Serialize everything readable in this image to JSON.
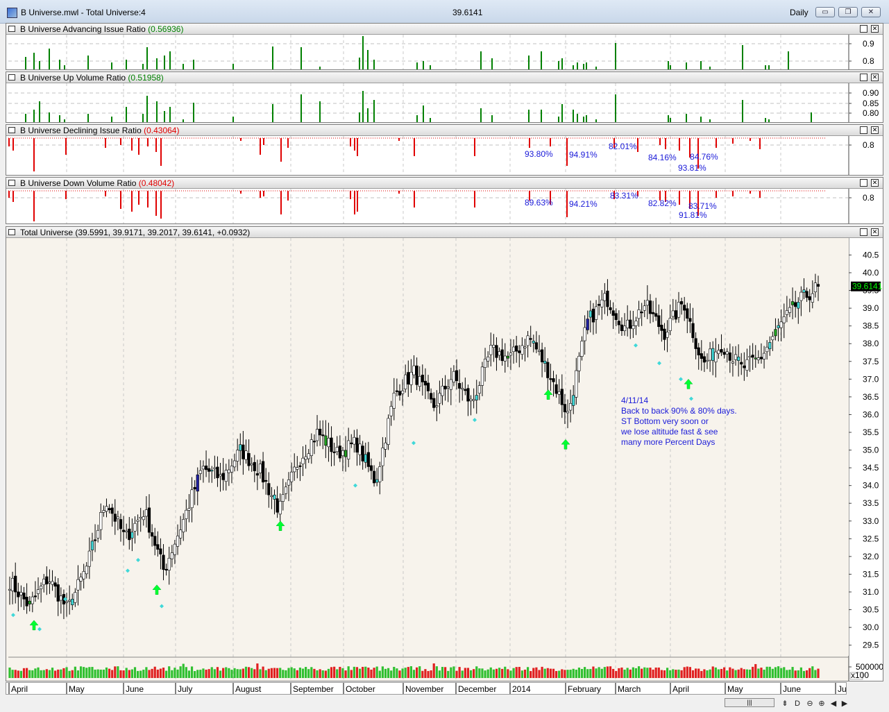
{
  "window": {
    "title": "B Universe.mwl - Total Universe:4",
    "last_price": "39.6141",
    "period": "Daily",
    "minimize_glyph": "▭",
    "restore_glyph": "❐",
    "close_glyph": "✕"
  },
  "panes": {
    "adv": {
      "name": "B Universe Advancing Issue Ratio",
      "value": "(0.56936)",
      "ticks": [
        "0.9",
        "0.8"
      ]
    },
    "upv": {
      "name": "B Universe Up Volume Ratio",
      "value": "(0.51958)",
      "ticks": [
        "0.90",
        "0.85",
        "0.80"
      ]
    },
    "dec": {
      "name": "B Universe Declining Issue Ratio",
      "value": "(0.43064)",
      "ticks": [
        "0.8"
      ],
      "annotations": [
        "93.80%",
        "94.91%",
        "82.01%",
        "84.16%",
        "84.76%",
        "93.81%"
      ]
    },
    "dnv": {
      "name": "B Universe Down Volume Ratio",
      "value": "(0.48042)",
      "ticks": [
        "0.8"
      ],
      "annotations": [
        "89.63%",
        "94.21%",
        "83.31%",
        "82.82%",
        "83.71%",
        "91.81%"
      ]
    },
    "price": {
      "name": "Total Universe",
      "value": "(39.5991, 39.9171, 39.2017, 39.6141, +0.0932)",
      "last_label": "39.6141"
    },
    "volume": {
      "tick": "500000",
      "scale_label": "x100"
    }
  },
  "note": {
    "lines": [
      "4/11/14",
      "Back to back 90% & 80% days.",
      "ST Bottom very soon or",
      "we lose altitude fast & see",
      "many more Percent Days"
    ]
  },
  "months": [
    "April",
    "May",
    "June",
    "July",
    "August",
    "September",
    "October",
    "November",
    "December",
    "2014",
    "February",
    "March",
    "April",
    "May",
    "June",
    "Jul"
  ],
  "colors": {
    "up": "#008000",
    "down": "#e00000",
    "annotation": "#1a1ad8",
    "chart_bg": "#f7f3ec",
    "last_price_bg": "#000000",
    "last_price_fg": "#00ff00",
    "arrow": "#00ff33",
    "dot": "#40d8d8"
  },
  "chart_data": {
    "type": "candlestick",
    "title": "Total Universe",
    "y_ticks": [
      29.5,
      30.0,
      30.5,
      31.0,
      31.5,
      32.0,
      32.5,
      33.0,
      33.5,
      34.0,
      34.5,
      35.0,
      35.5,
      36.0,
      36.5,
      37.0,
      37.5,
      38.0,
      38.5,
      39.0,
      39.5,
      40.0,
      40.5
    ],
    "ylim": [
      29.2,
      40.9
    ],
    "x_labels": [
      "April",
      "May",
      "June",
      "July",
      "August",
      "September",
      "October",
      "November",
      "December",
      "2014",
      "February",
      "March",
      "April",
      "May",
      "June",
      "Jul"
    ],
    "last": {
      "open": 39.5991,
      "high": 39.9171,
      "low": 39.2017,
      "close": 39.6141,
      "change": 0.0932
    },
    "close_path_anchors": [
      31.3,
      30.6,
      31.4,
      30.5,
      31.7,
      33.6,
      32.5,
      33.3,
      31.6,
      33.0,
      34.5,
      34.2,
      35.0,
      34.4,
      33.3,
      34.7,
      35.5,
      34.9,
      35.2,
      34.1,
      36.6,
      37.2,
      36.2,
      37.1,
      36.3,
      37.8,
      37.6,
      38.2,
      37.2,
      36.0,
      38.6,
      39.3,
      38.4,
      39.1,
      38.3,
      39.2,
      37.4,
      38.0,
      37.3,
      37.6,
      38.5,
      39.2,
      39.6
    ]
  }
}
